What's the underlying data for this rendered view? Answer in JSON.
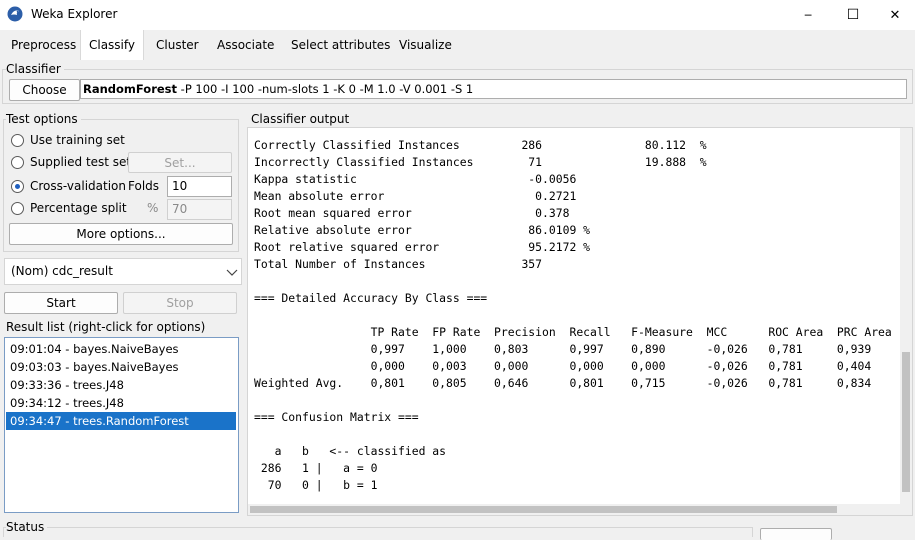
{
  "window": {
    "title": "Weka Explorer",
    "minimize_glyph": "─",
    "maximize_glyph": "☐",
    "close_glyph": "✕"
  },
  "tabs": [
    {
      "label": "Preprocess"
    },
    {
      "label": "Classify"
    },
    {
      "label": "Cluster"
    },
    {
      "label": "Associate"
    },
    {
      "label": "Select attributes"
    },
    {
      "label": "Visualize"
    }
  ],
  "classifier": {
    "group_label": "Classifier",
    "choose_label": "Choose",
    "name": "RandomForest",
    "options": " -P 100 -I 100 -num-slots 1 -K 0 -M 1.0 -V 0.001 -S 1"
  },
  "test_options": {
    "group_label": "Test options",
    "use_training": "Use training set",
    "supplied": "Supplied test set",
    "set_label": "Set...",
    "cross_validation": "Cross-validation",
    "folds_label": "Folds",
    "folds_value": "10",
    "percentage_split": "Percentage split",
    "percent_symbol": "%",
    "percent_value": "70",
    "more_options": "More options...",
    "selected": "cross_validation"
  },
  "class_attribute": {
    "value": "(Nom) cdc_result"
  },
  "actions": {
    "start": "Start",
    "stop": "Stop"
  },
  "result_list": {
    "group_label": "Result list (right-click for options)",
    "items": [
      "09:01:04 - bayes.NaiveBayes",
      "09:03:03 - bayes.NaiveBayes",
      "09:33:36 - trees.J48",
      "09:34:12 - trees.J48",
      "09:34:47 - trees.RandomForest"
    ],
    "selected_index": 4
  },
  "output": {
    "group_label": "Classifier output",
    "lines": [
      "Correctly Classified Instances         286               80.112  %",
      "Incorrectly Classified Instances        71               19.888  %",
      "Kappa statistic                         -0.0056",
      "Mean absolute error                      0.2721",
      "Root mean squared error                  0.378",
      "Relative absolute error                 86.0109 %",
      "Root relative squared error             95.2172 %",
      "Total Number of Instances              357",
      "",
      "=== Detailed Accuracy By Class ===",
      "",
      "                 TP Rate  FP Rate  Precision  Recall   F-Measure  MCC      ROC Area  PRC Area",
      "                 0,997    1,000    0,803      0,997    0,890      -0,026   0,781     0,939",
      "                 0,000    0,003    0,000      0,000    0,000      -0,026   0,781     0,404",
      "Weighted Avg.    0,801    0,805    0,646      0,801    0,715      -0,026   0,781     0,834",
      "",
      "=== Confusion Matrix ===",
      "",
      "   a   b   <-- classified as",
      " 286   1 |   a = 0",
      "  70   0 |   b = 1"
    ]
  },
  "status": {
    "group_label": "Status"
  },
  "icons": {
    "app": "weka-bird-icon",
    "dropdown": "chevron-down-icon"
  },
  "colors": {
    "selection": "#1a73c9",
    "radio_dot": "#1f5fbf"
  }
}
